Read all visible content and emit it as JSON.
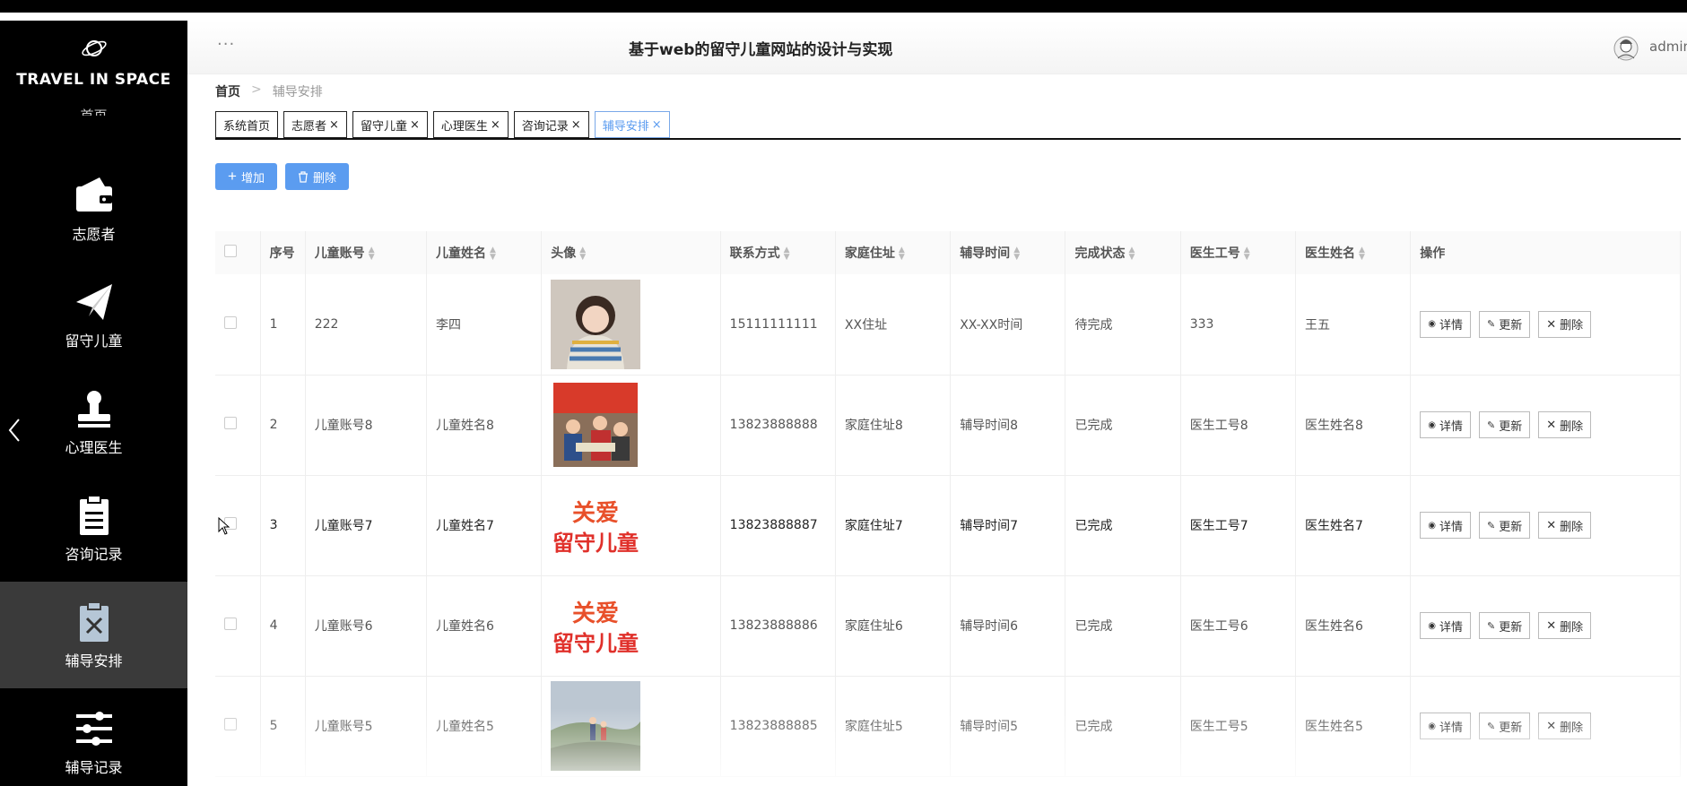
{
  "brand": {
    "name": "TRAVEL IN SPACE",
    "partial_menu": "首页"
  },
  "sidebar": {
    "items": [
      {
        "label": "志愿者",
        "icon": "wallet-icon",
        "active": false
      },
      {
        "label": "留守儿童",
        "icon": "paper-plane-icon",
        "active": false
      },
      {
        "label": "心理医生",
        "icon": "stamp-icon",
        "active": false
      },
      {
        "label": "咨询记录",
        "icon": "clipboard-icon",
        "active": false
      },
      {
        "label": "辅导安排",
        "icon": "clipboard-x-icon",
        "active": true
      },
      {
        "label": "辅导记录",
        "icon": "sliders-icon",
        "active": false
      }
    ]
  },
  "header": {
    "dots": "···",
    "title": "基于web的留守儿童网站的设计与实现",
    "user": "admin"
  },
  "breadcrumb": {
    "home": "首页",
    "sep": ">",
    "current": "辅导安排"
  },
  "tabs": [
    {
      "label": "系统首页",
      "closable": false
    },
    {
      "label": "志愿者",
      "closable": true
    },
    {
      "label": "留守儿童",
      "closable": true
    },
    {
      "label": "心理医生",
      "closable": true
    },
    {
      "label": "咨询记录",
      "closable": true
    },
    {
      "label": "辅导安排",
      "closable": true,
      "active": true
    }
  ],
  "toolbar": {
    "add_label": "增加",
    "delete_label": "删除",
    "accent": "#5b9cf0"
  },
  "table": {
    "columns": [
      "序号",
      "儿童账号",
      "儿童姓名",
      "头像",
      "联系方式",
      "家庭住址",
      "辅导时间",
      "完成状态",
      "医生工号",
      "医生姓名",
      "操作"
    ],
    "row_actions": {
      "detail": "详情",
      "update": "更新",
      "delete": "删除"
    },
    "rows": [
      {
        "no": "1",
        "account": "222",
        "name": "李四",
        "phone": "15111111111",
        "address": "XX住址",
        "time": "XX-XX时间",
        "status": "待完成",
        "doc_id": "333",
        "doc_name": "王五",
        "avatar": "child-photo"
      },
      {
        "no": "2",
        "account": "儿童账号8",
        "name": "儿童姓名8",
        "phone": "13823888888",
        "address": "家庭住址8",
        "time": "辅导时间8",
        "status": "已完成",
        "doc_id": "医生工号8",
        "doc_name": "医生姓名8",
        "avatar": "group-photo"
      },
      {
        "no": "3",
        "account": "儿童账号7",
        "name": "儿童姓名7",
        "phone": "13823888887",
        "address": "家庭住址7",
        "time": "辅导时间7",
        "status": "已完成",
        "doc_id": "医生工号7",
        "doc_name": "医生姓名7",
        "avatar": "logo-graphic"
      },
      {
        "no": "4",
        "account": "儿童账号6",
        "name": "儿童姓名6",
        "phone": "13823888886",
        "address": "家庭住址6",
        "time": "辅导时间6",
        "status": "已完成",
        "doc_id": "医生工号6",
        "doc_name": "医生姓名6",
        "avatar": "logo-graphic"
      },
      {
        "no": "5",
        "account": "儿童账号5",
        "name": "儿童姓名5",
        "phone": "13823888885",
        "address": "家庭住址5",
        "time": "辅导时间5",
        "status": "已完成",
        "doc_id": "医生工号5",
        "doc_name": "医生姓名5",
        "avatar": "landscape-photo"
      }
    ]
  }
}
